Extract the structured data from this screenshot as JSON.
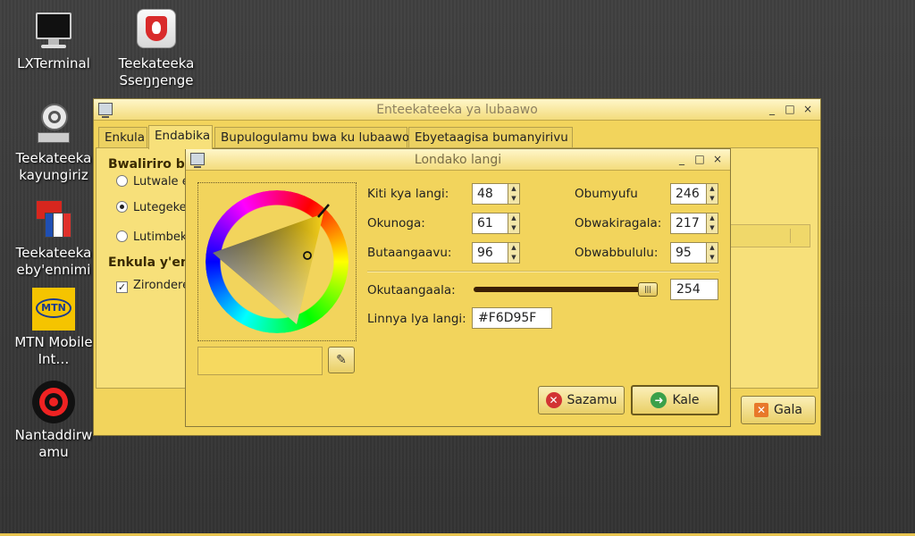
{
  "desktop": {
    "icons": [
      {
        "label": "LXTerminal",
        "icon": "terminal-icon"
      },
      {
        "label": "Teekateeka Sseŋŋenge",
        "icon": "firewall-shield-icon"
      },
      {
        "label": "Teekateeka kayungiriz",
        "icon": "network-settings-icon"
      },
      {
        "label": "Teekateeka eby'ennimi",
        "icon": "language-flags-icon"
      },
      {
        "label": "MTN Mobile Int…",
        "icon": "mtn-logo-icon",
        "logo_text": "MTN"
      },
      {
        "label": "Nantaddirwamu",
        "icon": "target-icon"
      }
    ]
  },
  "back_window": {
    "title": "Enteekateeka ya lubaawo",
    "controls": {
      "minimize": "_",
      "maximize": "□",
      "close": "×"
    },
    "tabs": [
      {
        "label": "Enkula",
        "active": false
      },
      {
        "label": "Endabika",
        "active": true
      },
      {
        "label": "Bupulogulamu bwa ku lubaawo",
        "active": false
      },
      {
        "label": "Ebyetaagisa bumanyirivu",
        "active": false
      }
    ],
    "section1_heading": "Bwaliriro bw",
    "radios": [
      {
        "label": "Lutwale e",
        "selected": false
      },
      {
        "label": "Lutegeke",
        "selected": true
      },
      {
        "label": "Lutimbek",
        "selected": false
      }
    ],
    "section2_heading": "Enkula y'enn",
    "checkbox": {
      "label": "Ziron­dere",
      "checked": true
    },
    "close_button": "Gala"
  },
  "color_dialog": {
    "title": "Londako langi",
    "controls": {
      "minimize": "_",
      "maximize": "□",
      "close": "×"
    },
    "fields": {
      "hue": {
        "label": "Kiti kya langi:",
        "value": "48"
      },
      "saturation": {
        "label": "Okunoga:",
        "value": "61"
      },
      "value": {
        "label": "Butaangaavu:",
        "value": "96"
      },
      "red": {
        "label": "Obumyufu",
        "value": "246"
      },
      "green": {
        "label": "Obwakiragala:",
        "value": "217"
      },
      "blue": {
        "label": "Obwabbululu:",
        "value": "95"
      }
    },
    "opacity": {
      "label": "Okutaangaala:",
      "value": "254",
      "fraction": 0.996
    },
    "color_name": {
      "label": "Linnya lya langi:",
      "value": "#F6D95F"
    },
    "current_color": "#F6D95F",
    "cancel_button": "Sazamu",
    "ok_button": "Kale"
  },
  "colors": {
    "accent": "#F6D95F",
    "cancel_icon": "#d23333",
    "ok_icon": "#3aa04a"
  }
}
